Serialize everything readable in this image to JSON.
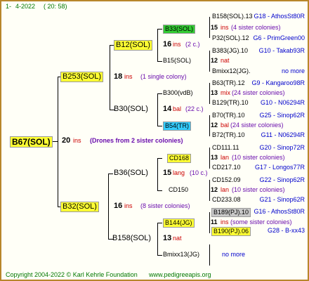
{
  "header": {
    "left": "1-",
    "date": "4-2022",
    "time": "( 20:  58)"
  },
  "footer": {
    "copyright": "Copyright 2004-2022 © Karl Kehrle Foundation",
    "website": "www.pedigreeapis.org"
  },
  "root": {
    "name": "B67(SOL)",
    "generation": "20",
    "unit": "ins",
    "note": "(Drones from 2 sister colonies)"
  },
  "gen1": [
    {
      "name": "B253(SOL)",
      "generation": "18",
      "unit": "ins",
      "note": "(1 single colony)"
    },
    {
      "name": "B32(SOL)",
      "generation": "16",
      "unit": "ins",
      "note": "(8 sister colonies)"
    }
  ],
  "gen2": [
    {
      "name": "B12(SOL)",
      "generation": "16",
      "unit": "ins",
      "note": "(2 c.)"
    },
    {
      "name": "B30(SOL)",
      "generation": "14",
      "unit": "bal",
      "note": "(22 c.)"
    },
    {
      "name": "B36(SOL)",
      "generation": "15",
      "unit": "lang",
      "note": "(10 c.)"
    },
    {
      "name": "B158(SOL)",
      "generation": "13",
      "unit": "nat",
      "note": ""
    }
  ],
  "gen3": [
    {
      "name": "B33(SOL)",
      "generation": "15",
      "unit": "ins",
      "note": "(4 sister colonies)"
    },
    {
      "name": "B15(SOL)",
      "generation": "12",
      "unit": "nat",
      "note": ""
    },
    {
      "name": "B300(vdB)",
      "generation": "13",
      "unit": "mix",
      "note": "(24 sister colonies)"
    },
    {
      "name": "B54(TR)",
      "generation": "12",
      "unit": "bal",
      "note": "(24 sister colonies)"
    },
    {
      "name": "CD168",
      "generation": "13",
      "unit": "lan",
      "note": "(10 sister colonies)"
    },
    {
      "name": "CD150",
      "generation": "12",
      "unit": "lan",
      "note": "(10 sister colonies)"
    },
    {
      "name": "B144(JG)",
      "generation": "11",
      "unit": "ins",
      "note": "(some sister colonies)"
    },
    {
      "name": "Bmixx13(JG)",
      "generation": "",
      "unit": "",
      "note": "no more"
    }
  ],
  "gen4": [
    {
      "name": "B158(SOL).13",
      "ref": "G18 - AthosSt80R"
    },
    {
      "name": "P32(SOL).12",
      "ref": "G6 - PrimGreen00"
    },
    {
      "name": "B383(JG).10",
      "ref": "G10 - Takab93R"
    },
    {
      "name": "Bmixx12(JG).",
      "ref": "no more"
    },
    {
      "name": "B63(TR).12",
      "ref": "G9 - Kangaroo98R"
    },
    {
      "name": "B129(TR).10",
      "ref": "G10 - N06294R"
    },
    {
      "name": "B70(TR).10",
      "ref": "G25 - Sinop62R"
    },
    {
      "name": "B72(TR).10",
      "ref": "G11 - N06294R"
    },
    {
      "name": "CD111.11",
      "ref": "G20 - Sinop72R"
    },
    {
      "name": "CD217.10",
      "ref": "G17 - Longos77R"
    },
    {
      "name": "CD152.09",
      "ref": "G22 - Sinop62R"
    },
    {
      "name": "CD233.08",
      "ref": "G21 - Sinop62R"
    },
    {
      "name": "B189(PJ).10",
      "ref": "G16 - AthosSt80R"
    },
    {
      "name": "B190(PJ).06",
      "ref": "G28 - B-xx43"
    }
  ]
}
